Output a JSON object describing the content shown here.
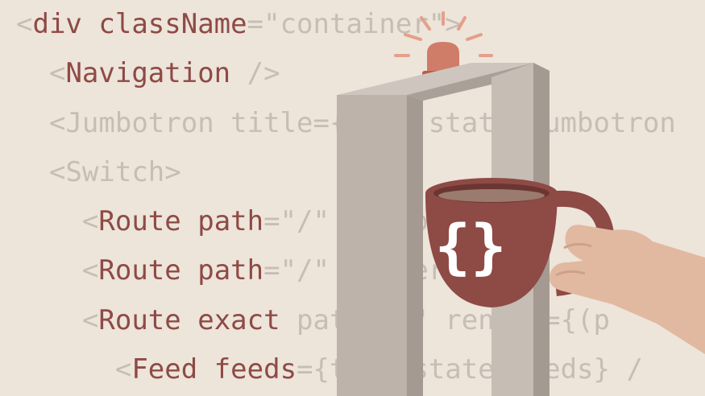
{
  "code_lines": [
    {
      "indent": "",
      "open": "<",
      "tag": "div",
      "sep": " ",
      "attr": "className",
      "rest": "=\"container\">"
    },
    {
      "indent": "  ",
      "open": "<",
      "tag": "Navigation",
      "sep": " ",
      "attr": "",
      "rest": "/>"
    },
    {
      "indent": "  ",
      "open": "<",
      "tag": "Jumbotron",
      "sep": " ",
      "attr": "title",
      "rest": "={this.state.jumbotron"
    },
    {
      "indent": "  ",
      "open": "<",
      "tag": "Switch",
      "sep": "",
      "attr": "",
      "rest": ">"
    },
    {
      "indent": "    ",
      "open": "<",
      "tag": "Route",
      "sep": " ",
      "attr": "path",
      "rest": "=\"/\" component={("
    },
    {
      "indent": "    ",
      "open": "<",
      "tag": "Route",
      "sep": " ",
      "attr": "path",
      "rest": "=\"/\" render={(Abo"
    },
    {
      "indent": "    ",
      "open": "<",
      "tag": "Route",
      "sep": " ",
      "attr": "exact",
      "rest": " path=\"/\" render={(p"
    },
    {
      "indent": "      ",
      "open": "<",
      "tag": "Feed",
      "sep": " ",
      "attr": "feeds",
      "rest": "={this.state.feeds} /"
    }
  ],
  "mug": {
    "logo": "{}"
  },
  "colors": {
    "background": "#ede4da",
    "code_dim": "#c6beb5",
    "code_accent": "#8e4a45",
    "mug": "#8e4a45",
    "frame": "#b6aca3",
    "light": "#e3b198",
    "hand": "#e1b9a0"
  }
}
